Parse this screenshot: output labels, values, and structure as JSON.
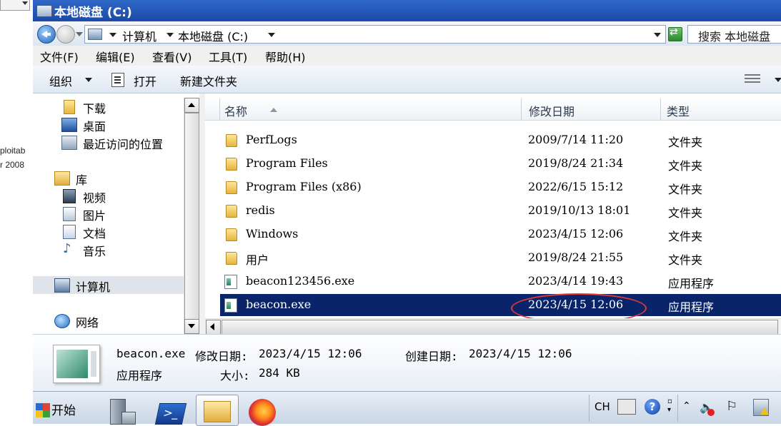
{
  "background_window": {
    "texts": [
      "ploitab",
      "r 2008"
    ]
  },
  "window": {
    "title": "本地磁盘 (C:)"
  },
  "address_bar": {
    "breadcrumb": [
      "计算机",
      "本地磁盘 (C:)"
    ],
    "search_placeholder": "搜索 本地磁盘"
  },
  "menu": {
    "items": [
      "文件(F)",
      "编辑(E)",
      "查看(V)",
      "工具(T)",
      "帮助(H)"
    ]
  },
  "toolbar": {
    "organize": "组织",
    "open": "打开",
    "new_folder": "新建文件夹"
  },
  "nav_pane": {
    "items": [
      {
        "label": "下载",
        "icon": "download-folder-icon"
      },
      {
        "label": "桌面",
        "icon": "desktop-icon"
      },
      {
        "label": "最近访问的位置",
        "icon": "recent-places-icon"
      },
      {
        "label": "库",
        "icon": "library-icon"
      },
      {
        "label": "视频",
        "icon": "videos-icon"
      },
      {
        "label": "图片",
        "icon": "pictures-icon"
      },
      {
        "label": "文档",
        "icon": "documents-icon"
      },
      {
        "label": "音乐",
        "icon": "music-icon"
      },
      {
        "label": "计算机",
        "icon": "computer-icon"
      },
      {
        "label": "网络",
        "icon": "network-icon"
      }
    ],
    "selected": "计算机"
  },
  "file_list": {
    "columns": [
      "名称",
      "修改日期",
      "类型"
    ],
    "rows": [
      {
        "name": "PerfLogs",
        "date": "2009/7/14 11:20",
        "type": "文件夹",
        "icon": "folder-icon"
      },
      {
        "name": "Program Files",
        "date": "2019/8/24 21:34",
        "type": "文件夹",
        "icon": "folder-icon"
      },
      {
        "name": "Program Files (x86)",
        "date": "2022/6/15 15:12",
        "type": "文件夹",
        "icon": "folder-icon"
      },
      {
        "name": "redis",
        "date": "2019/10/13 18:01",
        "type": "文件夹",
        "icon": "folder-icon"
      },
      {
        "name": "Windows",
        "date": "2023/4/15 12:06",
        "type": "文件夹",
        "icon": "folder-icon"
      },
      {
        "name": "用户",
        "date": "2019/8/24 21:55",
        "type": "文件夹",
        "icon": "folder-icon"
      },
      {
        "name": "beacon123456.exe",
        "date": "2023/4/14 19:43",
        "type": "应用程序",
        "icon": "exe-icon"
      },
      {
        "name": "beacon.exe",
        "date": "2023/4/15 12:06",
        "type": "应用程序",
        "icon": "exe-icon"
      }
    ],
    "selected": "beacon.exe",
    "highlight_color": "#0a246a",
    "annotation_color": "#e03a3a"
  },
  "details": {
    "name": "beacon.exe",
    "modified_label": "修改日期:",
    "modified": "2023/4/15 12:06",
    "created_label": "创建日期:",
    "created": "2023/4/15 12:06",
    "type": "应用程序",
    "size_label": "大小:",
    "size": "284 KB"
  },
  "taskbar": {
    "start": "开始",
    "apps": [
      "server-manager-icon",
      "powershell-icon",
      "explorer-icon",
      "firefox-icon"
    ],
    "tray": {
      "lang": "CH"
    }
  }
}
